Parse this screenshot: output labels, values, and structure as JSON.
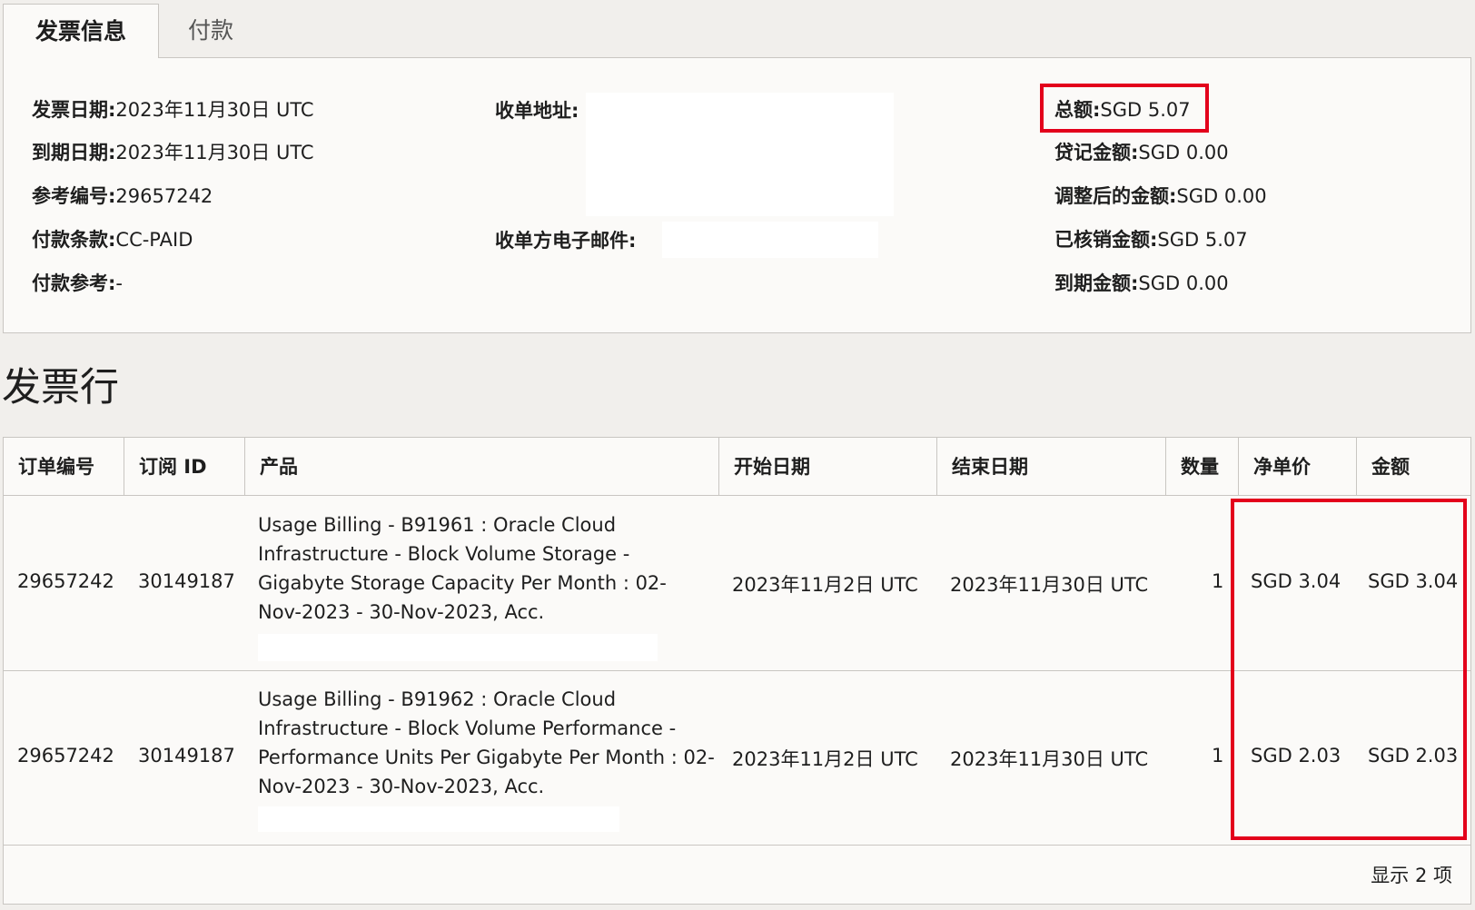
{
  "tabs": [
    {
      "label": "发票信息",
      "active": true
    },
    {
      "label": "付款",
      "active": false
    }
  ],
  "invoice_info": {
    "invoice_date": {
      "label": "发票日期:",
      "value": "2023年11月30日 UTC"
    },
    "due_date": {
      "label": "到期日期:",
      "value": "2023年11月30日 UTC"
    },
    "reference_number": {
      "label": "参考编号:",
      "value": "29657242"
    },
    "payment_terms": {
      "label": "付款条款:",
      "value": "CC-PAID"
    },
    "payment_reference": {
      "label": "付款参考:",
      "value": "-"
    },
    "billing_address": {
      "label": "收单地址:"
    },
    "billing_email": {
      "label": "收单方电子邮件:"
    },
    "total": {
      "label": "总额:",
      "value": "SGD 5.07"
    },
    "credit_amount": {
      "label": "贷记金额:",
      "value": "SGD 0.00"
    },
    "adjusted_amount": {
      "label": "调整后的金额:",
      "value": "SGD 0.00"
    },
    "applied_amount": {
      "label": "已核销金额:",
      "value": "SGD 5.07"
    },
    "amount_due": {
      "label": "到期金额:",
      "value": "SGD 0.00"
    }
  },
  "lines_section": {
    "title": "发票行",
    "columns": [
      "订单编号",
      "订阅 ID",
      "产品",
      "开始日期",
      "结束日期",
      "数量",
      "净单价",
      "金额"
    ],
    "rows": [
      {
        "order_number": "29657242",
        "subscription_id": "30149187",
        "product": "Usage Billing - B91961 : Oracle Cloud Infrastructure - Block Volume Storage - Gigabyte Storage Capacity Per Month : 02-Nov-2023 - 30-Nov-2023, Acc.",
        "start_date": "2023年11月2日 UTC",
        "end_date": "2023年11月30日 UTC",
        "quantity": "1",
        "net_unit_price": "SGD 3.04",
        "amount": "SGD 3.04"
      },
      {
        "order_number": "29657242",
        "subscription_id": "30149187",
        "product": "Usage Billing - B91962 : Oracle Cloud Infrastructure - Block Volume Performance - Performance Units Per Gigabyte Per Month : 02-Nov-2023 - 30-Nov-2023, Acc.",
        "start_date": "2023年11月2日 UTC",
        "end_date": "2023年11月30日 UTC",
        "quantity": "1",
        "net_unit_price": "SGD 2.03",
        "amount": "SGD 2.03"
      }
    ],
    "footer": "显示 2 项"
  },
  "colors": {
    "highlight": "#e3001b",
    "border": "#c9c6c2",
    "panel": "#fbfaf8",
    "background": "#f1efec"
  }
}
